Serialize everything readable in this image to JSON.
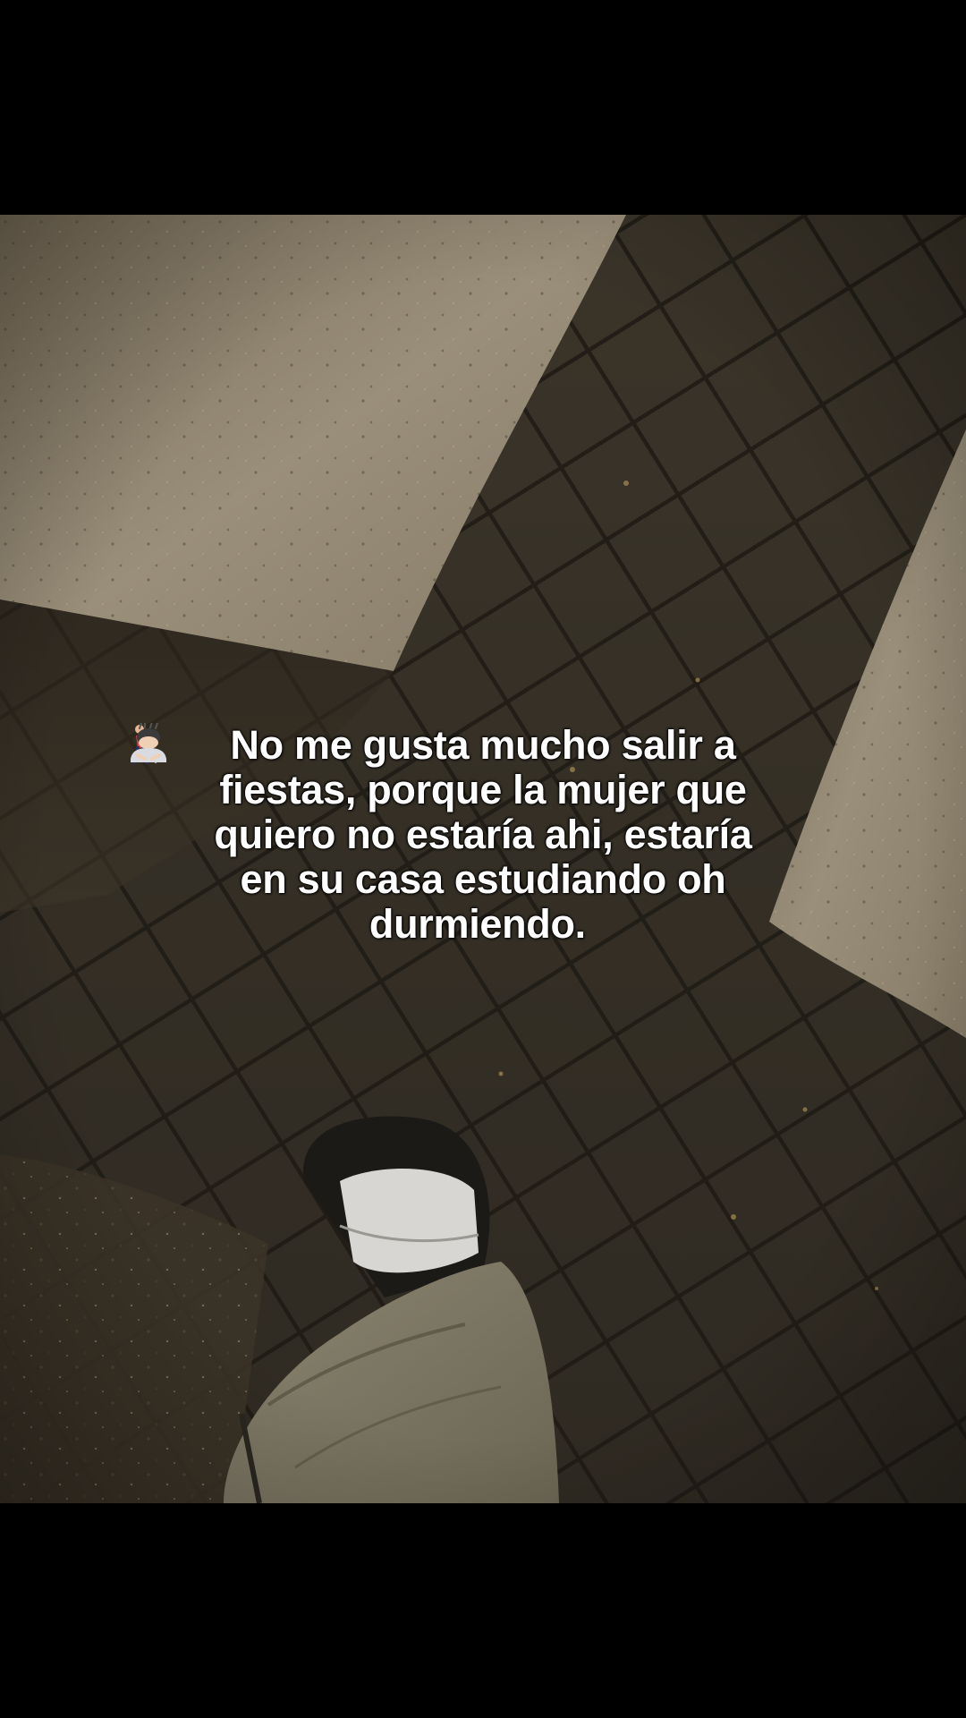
{
  "caption": {
    "text": "No me gusta mucho salir a\nfiestas, porque la mujer que\nquiero no estaría ahi, estaría\nen su casa estudiando oh\ndurmiendo."
  },
  "caption_icons": [
    "walking-with-cane-emoji",
    "person-bowing-emoji"
  ],
  "colors": {
    "letterbox": "#000000",
    "concrete": "#8c806c",
    "pavers": "#3a352c",
    "caption_text": "#ffffff"
  }
}
